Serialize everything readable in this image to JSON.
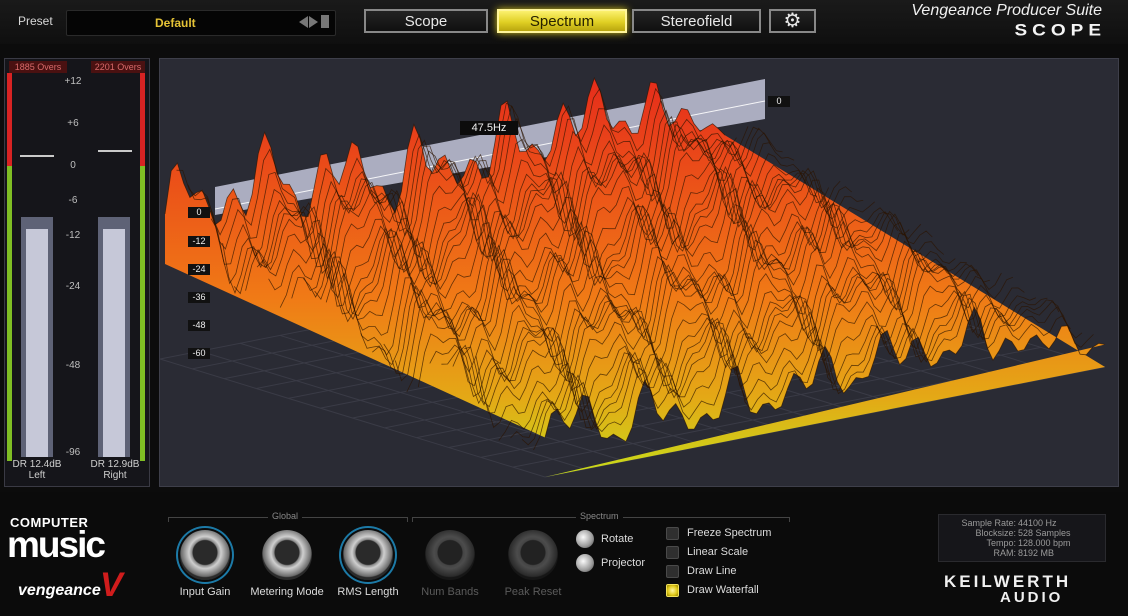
{
  "header": {
    "preset_label": "Preset",
    "preset_value": "Default",
    "tabs": [
      {
        "label": "Scope",
        "active": false
      },
      {
        "label": "Spectrum",
        "active": true
      },
      {
        "label": "Stereofield",
        "active": false
      }
    ],
    "settings_icon": "gear-icon",
    "suite_title": "Vengeance Producer Suite",
    "product_logo": "SCOPE"
  },
  "meters": {
    "left": {
      "overs": "1885 Overs",
      "dr": "DR 12.4dB",
      "channel": "Left"
    },
    "right": {
      "overs": "2201 Overs",
      "dr": "DR 12.9dB",
      "channel": "Right"
    },
    "scale": [
      "+12",
      "+6",
      "0",
      "-6",
      "-12",
      "-24",
      "-48",
      "-96"
    ],
    "accent_red": "#d72323",
    "accent_green": "#7fbd24"
  },
  "spectrum": {
    "db_labels": [
      "0",
      "-12",
      "-24",
      "-36",
      "-48",
      "-60"
    ],
    "top_right_label": "0",
    "cursor_freq": "47.5Hz",
    "gradient_top": "#e8301c",
    "gradient_bottom": "#c5dc1a"
  },
  "controls": {
    "global_title": "Global",
    "spectrum_title": "Spectrum",
    "knobs": [
      {
        "label": "Input Gain",
        "enabled": true
      },
      {
        "label": "Metering Mode",
        "enabled": true
      },
      {
        "label": "RMS Length",
        "enabled": true
      },
      {
        "label": "Num Bands",
        "enabled": false
      },
      {
        "label": "Peak Reset",
        "enabled": false
      }
    ],
    "rotate_label": "Rotate",
    "projector_label": "Projector",
    "toggles": [
      {
        "label": "Freeze Spectrum",
        "on": false
      },
      {
        "label": "Linear Scale",
        "on": false
      },
      {
        "label": "Draw Line",
        "on": false
      },
      {
        "label": "Draw Waterfall",
        "on": true
      }
    ]
  },
  "info": {
    "rows": [
      {
        "key": "Sample Rate:",
        "value": "44100 Hz"
      },
      {
        "key": "Blocksize:",
        "value": "528 Samples"
      },
      {
        "key": "Tempo:",
        "value": "128.000 bpm"
      },
      {
        "key": "RAM:",
        "value": "8192 MB"
      }
    ]
  },
  "logos": {
    "cm_line1": "COMPUTER",
    "cm_line2": "music",
    "vengeance": "vengeance",
    "vengeance_v": "V",
    "keilwerth_1": "KEILWERTH",
    "keilwerth_2": "AUDIO"
  }
}
